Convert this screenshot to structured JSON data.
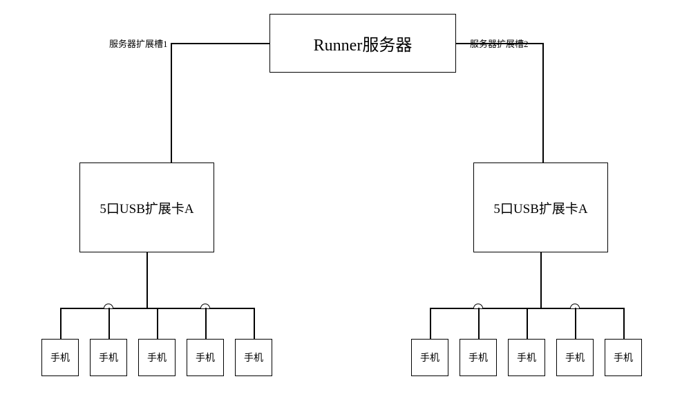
{
  "server": {
    "title": "Runner服务器"
  },
  "labels": {
    "slot1": "服务器扩展槽1",
    "slot2": "服务器扩展槽2"
  },
  "usb": {
    "left": "5口USB扩展卡A",
    "right": "5口USB扩展卡A"
  },
  "phones": {
    "p1": "手机",
    "p2": "手机",
    "p3": "手机",
    "p4": "手机",
    "p5": "手机",
    "p6": "手机",
    "p7": "手机",
    "p8": "手机",
    "p9": "手机",
    "p10": "手机"
  }
}
